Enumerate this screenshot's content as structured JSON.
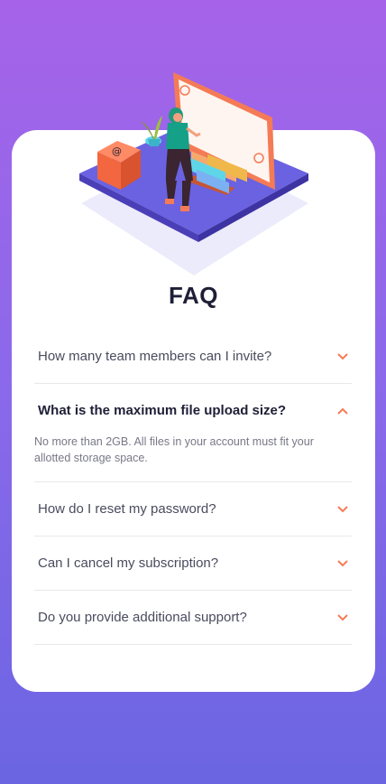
{
  "title": "FAQ",
  "colors": {
    "accent": "#f47b56",
    "heading": "#1e1f36",
    "text": "#4a4b5e",
    "muted": "#787887",
    "bg_top": "#a663e9",
    "bg_bottom": "#6b65e2"
  },
  "faq": [
    {
      "question": "How many team members can I invite?",
      "open": false
    },
    {
      "question": "What is the maximum file upload size?",
      "open": true,
      "answer": "No more than 2GB. All files in your account must fit your allotted storage space."
    },
    {
      "question": "How do I reset my password?",
      "open": false
    },
    {
      "question": "Can I cancel my subscription?",
      "open": false
    },
    {
      "question": "Do you provide additional support?",
      "open": false
    }
  ],
  "icons": {
    "collapsed": "chevron-down-icon",
    "expanded": "chevron-up-icon"
  }
}
